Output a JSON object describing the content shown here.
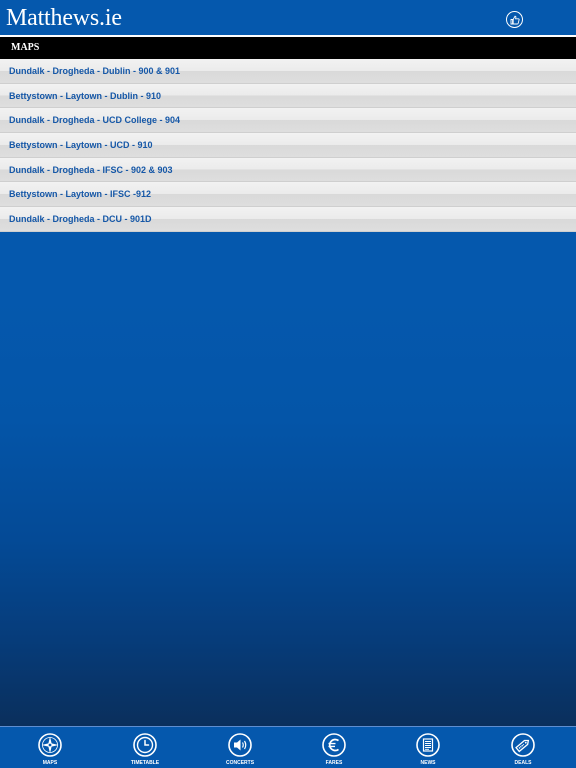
{
  "header": {
    "title": "Matthews.ie",
    "like_icon": "thumbs-up-icon"
  },
  "section": {
    "title": "MAPS"
  },
  "routes": [
    {
      "label": "Dundalk - Drogheda - Dublin - 900 & 901"
    },
    {
      "label": "Bettystown - Laytown - Dublin - 910"
    },
    {
      "label": "Dundalk - Drogheda - UCD College - 904"
    },
    {
      "label": "Bettystown - Laytown - UCD - 910"
    },
    {
      "label": "Dundalk - Drogheda - IFSC - 902 & 903"
    },
    {
      "label": "Bettystown - Laytown - IFSC -912"
    },
    {
      "label": "Dundalk - Drogheda - DCU - 901D"
    }
  ],
  "tabs": [
    {
      "label": "MAPS",
      "icon": "compass-icon"
    },
    {
      "label": "TIMETABLE",
      "icon": "clock-icon"
    },
    {
      "label": "CONCERTS",
      "icon": "speaker-icon"
    },
    {
      "label": "FARES",
      "icon": "euro-icon"
    },
    {
      "label": "NEWS",
      "icon": "newspaper-icon"
    },
    {
      "label": "DEALS",
      "icon": "tag-icon"
    }
  ],
  "colors": {
    "brand_blue": "#0558ad",
    "link_blue": "#1557a7",
    "section_bar": "#000000"
  }
}
